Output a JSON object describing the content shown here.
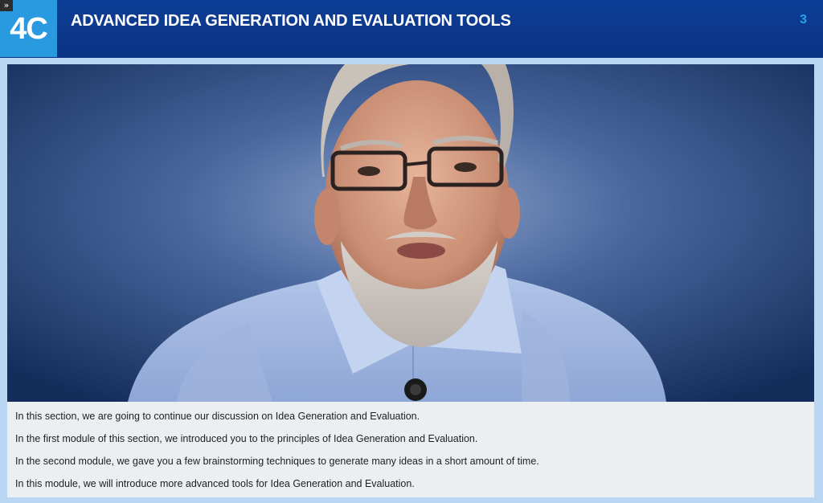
{
  "header": {
    "toggle_glyph": "»",
    "module_badge": "4C",
    "title": "ADVANCED IDEA GENERATION AND EVALUATION TOOLS",
    "page_number": "3"
  },
  "video": {
    "content": "presenter-video"
  },
  "transcript": {
    "lines": [
      "In this section, we are going to continue our discussion on Idea Generation and Evaluation.",
      "In the first module of this section, we introduced you to the principles of Idea Generation and Evaluation.",
      "In the second module, we gave you a few brainstorming techniques to generate many ideas in a short amount of time.",
      "In this module, we will introduce more advanced tools for Idea Generation and Evaluation."
    ]
  },
  "colors": {
    "header_bg": "#0b3789",
    "badge_bg": "#2a9ae0",
    "page_number": "#29a3ea",
    "panel_border": "#b9d6f3",
    "transcript_bg": "#eceff2"
  },
  "icons": {
    "expand": "double-chevron-right-icon"
  }
}
